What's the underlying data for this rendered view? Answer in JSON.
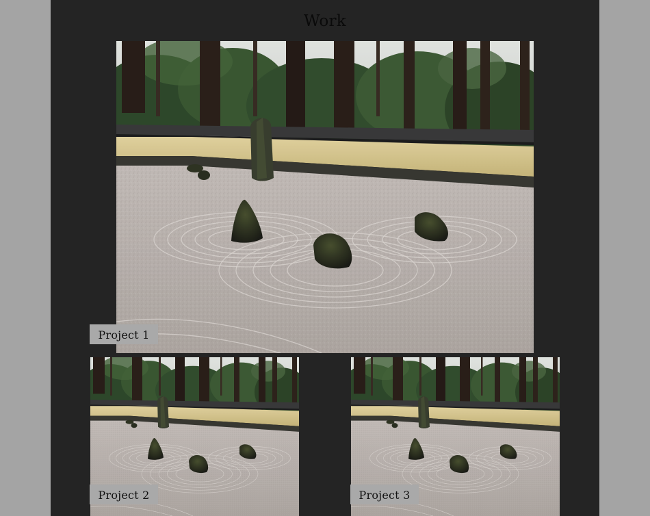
{
  "page": {
    "title": "Work"
  },
  "projects": [
    {
      "label": "Project 1",
      "image": "zen-garden-photo"
    },
    {
      "label": "Project 2",
      "image": "zen-garden-photo"
    },
    {
      "label": "Project 3",
      "image": "zen-garden-photo"
    }
  ],
  "colors": {
    "page_background": "#a4a4a4",
    "panel_background": "#242424",
    "label_background": "#a9a9a9",
    "title_text": "#0a0a0a"
  }
}
